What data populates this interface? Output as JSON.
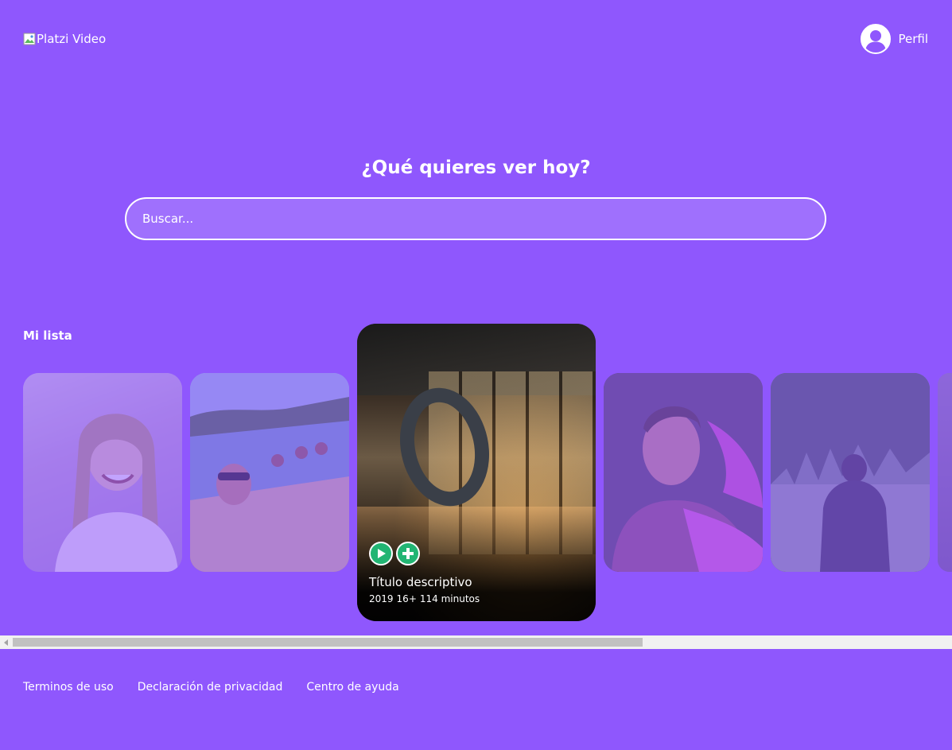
{
  "header": {
    "logo_alt": "Platzi Video",
    "profile_label": "Perfil",
    "profile_icon": "user-avatar-icon"
  },
  "hero": {
    "title": "¿Qué quieres ver hoy?",
    "search_placeholder": "Buscar...",
    "search_value": ""
  },
  "carousel": {
    "title": "Mi lista",
    "featured": {
      "title": "Título descriptivo",
      "year": "2019",
      "rating": "16+",
      "duration": "114 minutos",
      "play_icon": "play-icon",
      "add_icon": "plus-icon"
    }
  },
  "footer": {
    "links": [
      "Terminos de uso",
      "Declaración de privacidad",
      "Centro de ayuda"
    ]
  },
  "colors": {
    "background": "#8f57fd",
    "accent_green": "#22b573",
    "text": "#ffffff"
  }
}
